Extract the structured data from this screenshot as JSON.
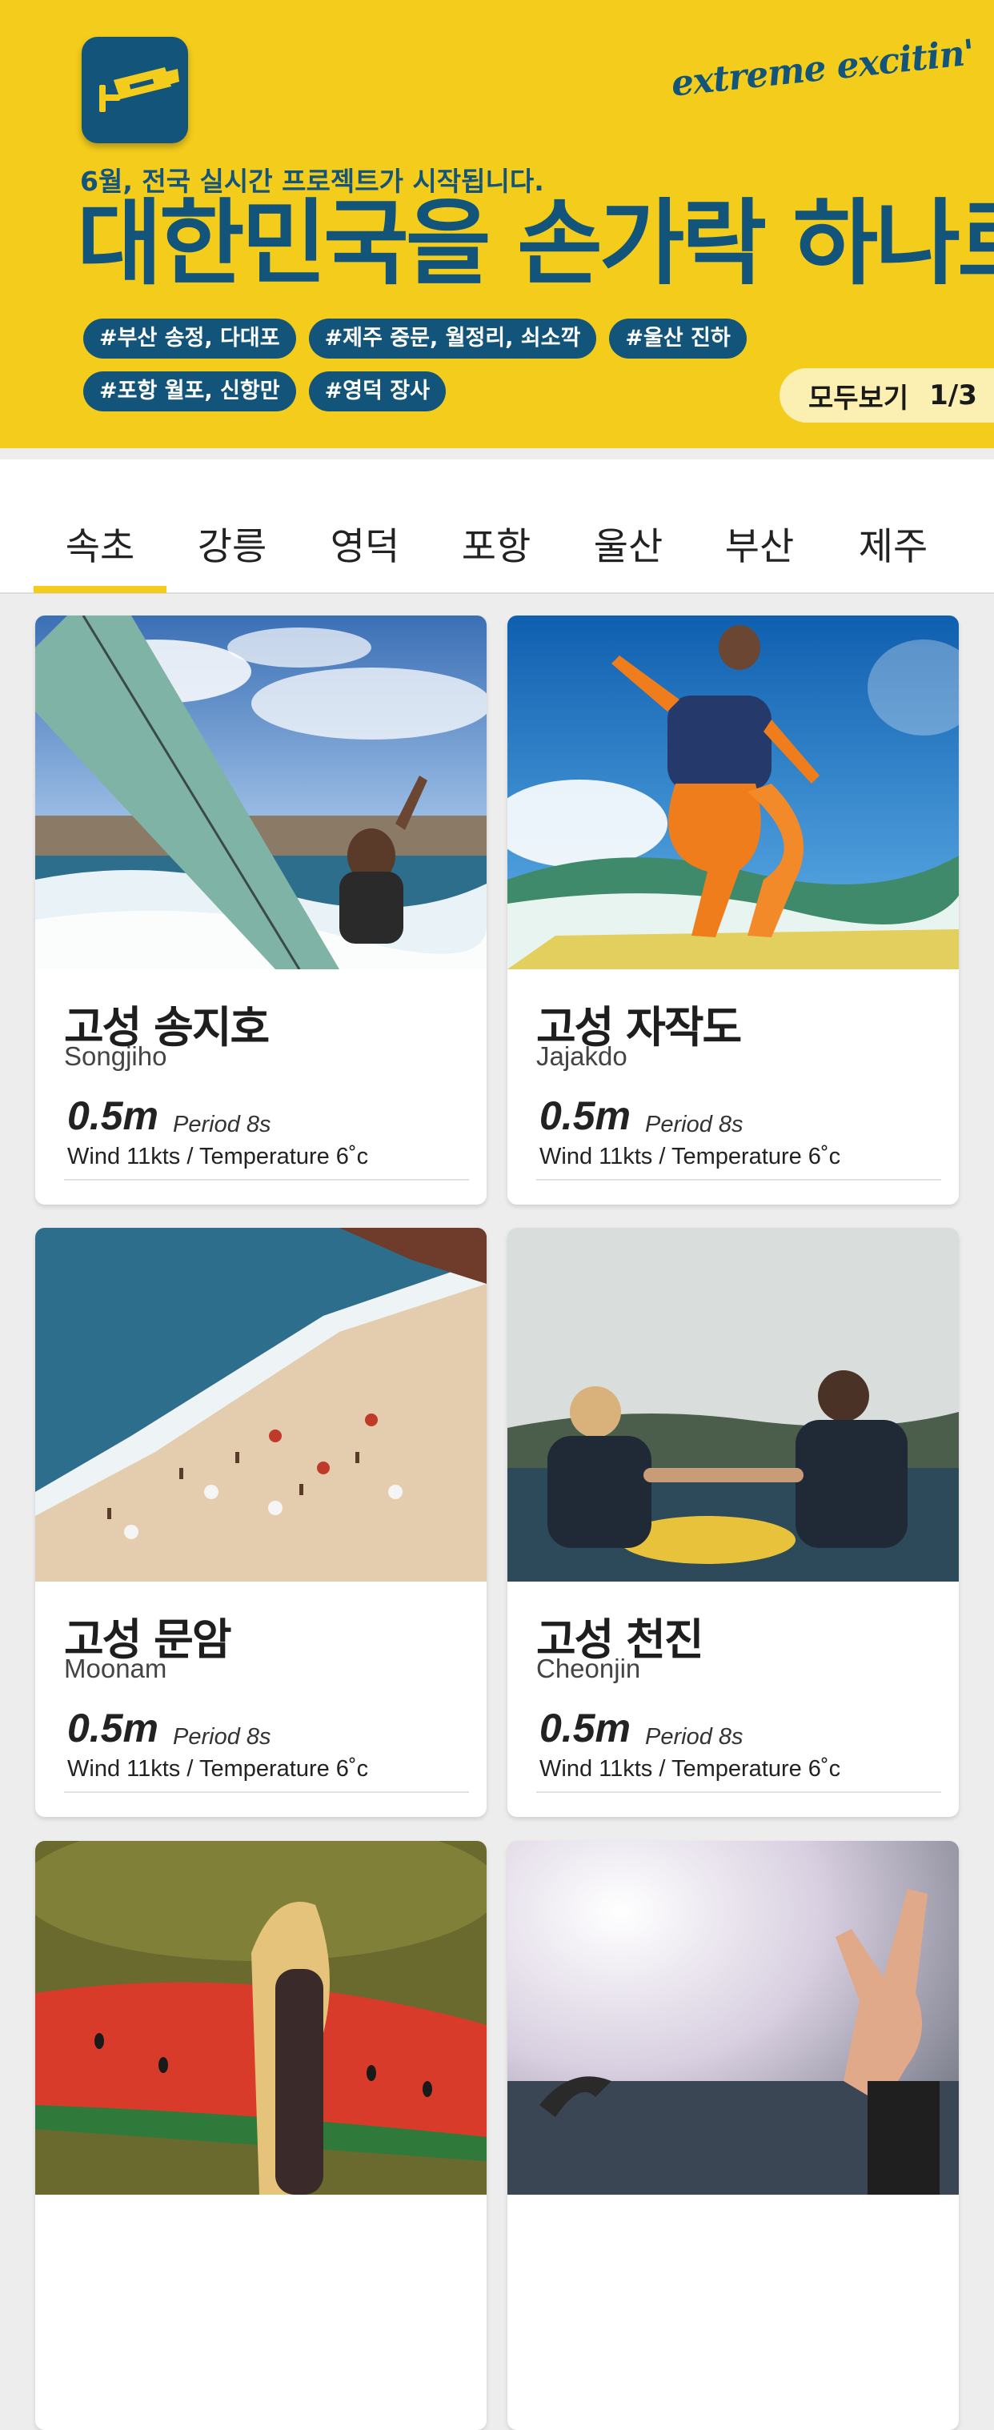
{
  "banner": {
    "tagline": "extreme excitin'",
    "subtitle": "6월, 전국 실시간 프로젝트가 시작됩니다.",
    "title": "대한민국을 손가락 하나로",
    "hashtags": [
      "#부산 송정, 다대포",
      "#제주 중문, 월정리, 쇠소깍",
      "#울산 진하",
      "#포항 월포, 신항만",
      "#영덕 장사"
    ],
    "view_all_label": "모두보기",
    "page_indicator": "1/3",
    "colors": {
      "background": "#f4cc1c",
      "brand": "#13557a"
    },
    "logo_icon": "cctv-camera-icon"
  },
  "tabs": {
    "items": [
      "속초",
      "강릉",
      "영덕",
      "포항",
      "울산",
      "부산",
      "제주"
    ],
    "selected": "속초",
    "accent": "#f4cc1c"
  },
  "spots": [
    {
      "title": "고성 송지호",
      "roman": "Songjiho",
      "wave_height": "0.5m",
      "period": "Period 8s",
      "wind_temp": "Wind 11kts / Temperature 6˚c"
    },
    {
      "title": "고성 자작도",
      "roman": "Jajakdo",
      "wave_height": "0.5m",
      "period": "Period 8s",
      "wind_temp": "Wind 11kts / Temperature 6˚c"
    },
    {
      "title": "고성 문암",
      "roman": "Moonam",
      "wave_height": "0.5m",
      "period": "Period 8s",
      "wind_temp": "Wind 11kts / Temperature 6˚c"
    },
    {
      "title": "고성 천진",
      "roman": "Cheonjin",
      "wave_height": "0.5m",
      "period": "Period 8s",
      "wind_temp": "Wind 11kts / Temperature 6˚c"
    },
    {
      "title": "",
      "roman": "",
      "wave_height": "",
      "period": "",
      "wind_temp": ""
    },
    {
      "title": "",
      "roman": "",
      "wave_height": "",
      "period": "",
      "wind_temp": ""
    }
  ]
}
